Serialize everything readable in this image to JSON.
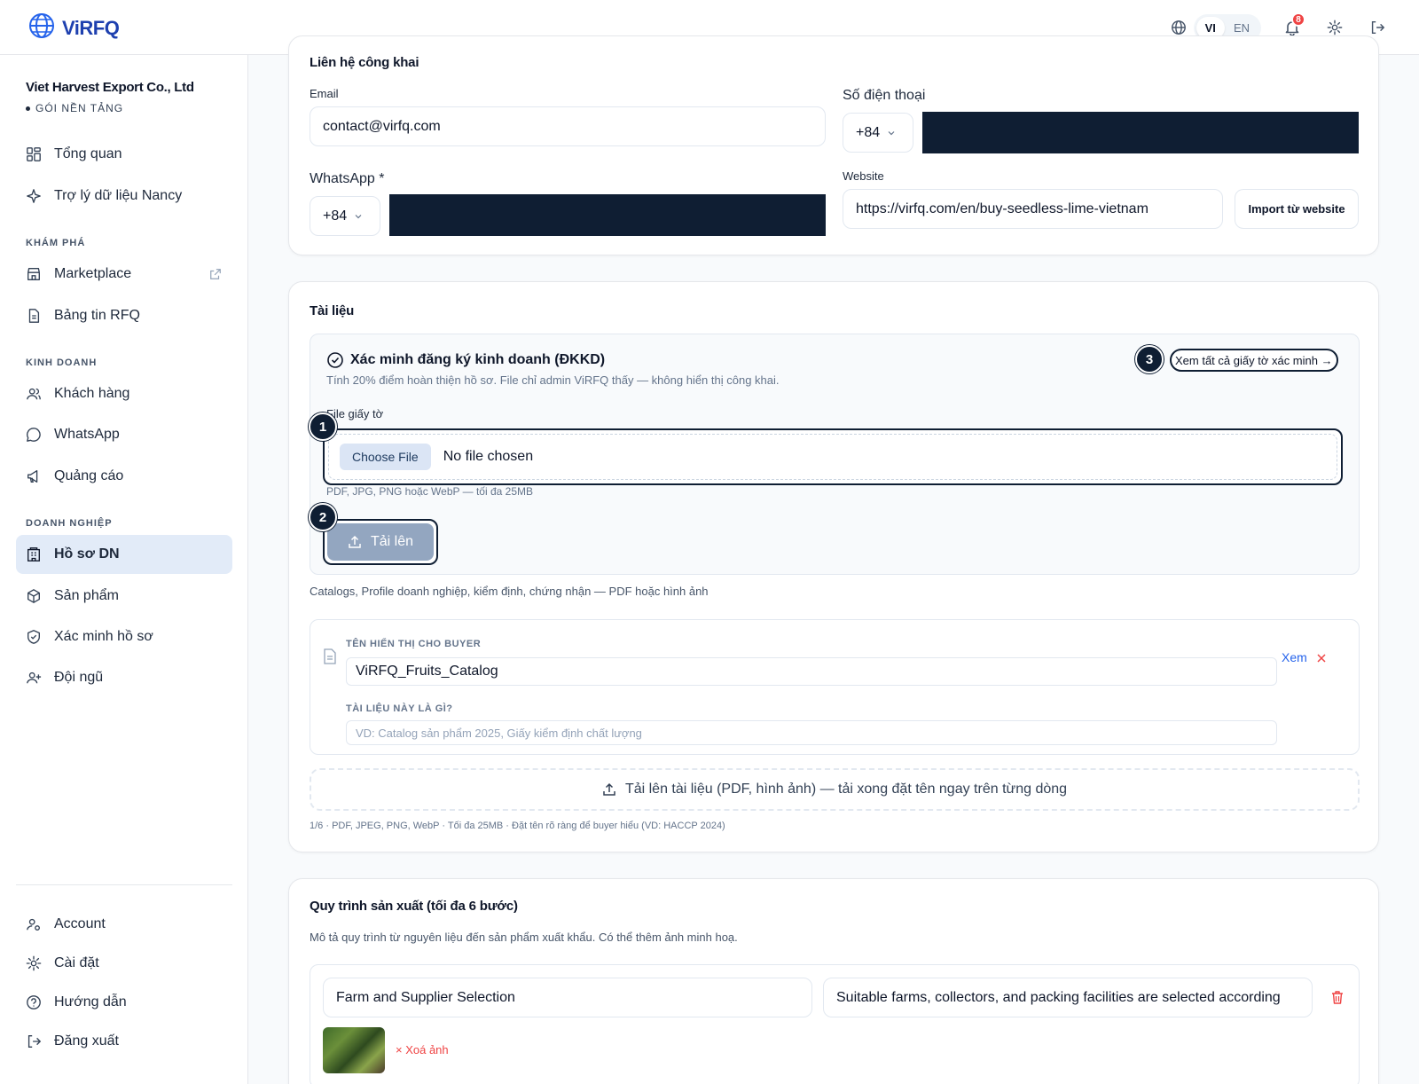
{
  "app": {
    "logo_text": "ViRFQ",
    "brand_color": "#1e40af"
  },
  "topbar": {
    "lang_vi": "VI",
    "lang_en": "EN",
    "notification_count": "8"
  },
  "sidebar": {
    "company_name": "Viet Harvest Export Co., Ltd",
    "company_plan": "GÓI NỀN TẢNG",
    "items": [
      {
        "label": "Tổng quan",
        "icon": "grid-icon"
      },
      {
        "label": "Trợ lý dữ liệu Nancy",
        "icon": "sparkle-icon"
      },
      {
        "label": "Marketplace",
        "icon": "store-icon"
      },
      {
        "label": "Bảng tin RFQ",
        "icon": "document-icon"
      },
      {
        "label": "Khách hàng",
        "icon": "users-icon"
      },
      {
        "label": "WhatsApp",
        "icon": "chat-icon"
      },
      {
        "label": "Quảng cáo",
        "icon": "megaphone-icon"
      },
      {
        "label": "Hồ sơ DN",
        "icon": "building-icon"
      },
      {
        "label": "Sản phẩm",
        "icon": "box-icon"
      },
      {
        "label": "Xác minh hồ sơ",
        "icon": "shield-check-icon"
      },
      {
        "label": "Đội ngũ",
        "icon": "user-plus-icon"
      },
      {
        "label": "Account",
        "icon": "user-cog-icon"
      },
      {
        "label": "Cài đặt",
        "icon": "gear-icon"
      },
      {
        "label": "Hướng dẫn",
        "icon": "help-icon"
      },
      {
        "label": "Đăng xuất",
        "icon": "logout-icon"
      }
    ],
    "sections": [
      "KHÁM PHÁ",
      "KINH DOANH",
      "DOANH NGHIỆP"
    ]
  },
  "contact": {
    "title": "Liên hệ công khai",
    "email_label": "Email",
    "email_value": "contact@virfq.com",
    "phone_label": "Số điện thoại",
    "phone_prefix": "+84",
    "whatsapp_label": "WhatsApp *",
    "whatsapp_prefix": "+84",
    "website_label": "Website",
    "website_value": "https://virfq.com/en/buy-seedless-lime-vietnam",
    "import_button": "Import từ website"
  },
  "documents": {
    "title": "Tài liệu",
    "verify_title": "Xác minh đăng ký kinh doanh (ĐKKD)",
    "verify_sub": "Tính 20% điểm hoàn thiện hồ sơ. File chỉ admin ViRFQ thấy — không hiển thị công khai.",
    "view_all": "Xem tất cả giấy tờ xác minh →",
    "file_label": "File giấy tờ",
    "choose_file": "Choose File",
    "no_file": "No file chosen",
    "file_hint": "PDF, JPG, PNG hoặc WebP — tối đa 25MB",
    "upload_button": "Tải lên",
    "catalog_desc": "Catalogs, Profile doanh nghiệp, kiểm định, chứng nhận — PDF hoặc hình ảnh",
    "display_name_label": "TÊN HIỂN THỊ CHO BUYER",
    "display_name_value": "ViRFQ_Fruits_Catalog",
    "what_label": "TÀI LIỆU NÀY LÀ GÌ?",
    "what_placeholder": "VD: Catalog sản phẩm 2025, Giấy kiểm định chất lượng",
    "view_link": "Xem",
    "upload_docs": "Tải lên tài liệu (PDF, hình ảnh) — tải xong đặt tên ngay trên từng dòng",
    "footer_hint": "1/6 · PDF, JPEG, PNG, WebP · Tối đa 25MB · Đặt tên rõ ràng để buyer hiểu (VD: HACCP 2024)",
    "steps": [
      "1",
      "2",
      "3"
    ]
  },
  "process": {
    "title": "Quy trình sản xuất (tối đa 6 bước)",
    "desc": "Mô tả quy trình từ nguyên liệu đến sản phẩm xuất khẩu. Có thể thêm ảnh minh hoạ.",
    "step_name": "Farm and Supplier Selection",
    "step_desc": "Suitable farms, collectors, and packing facilities are selected according",
    "remove_image": "× Xoá ảnh"
  }
}
